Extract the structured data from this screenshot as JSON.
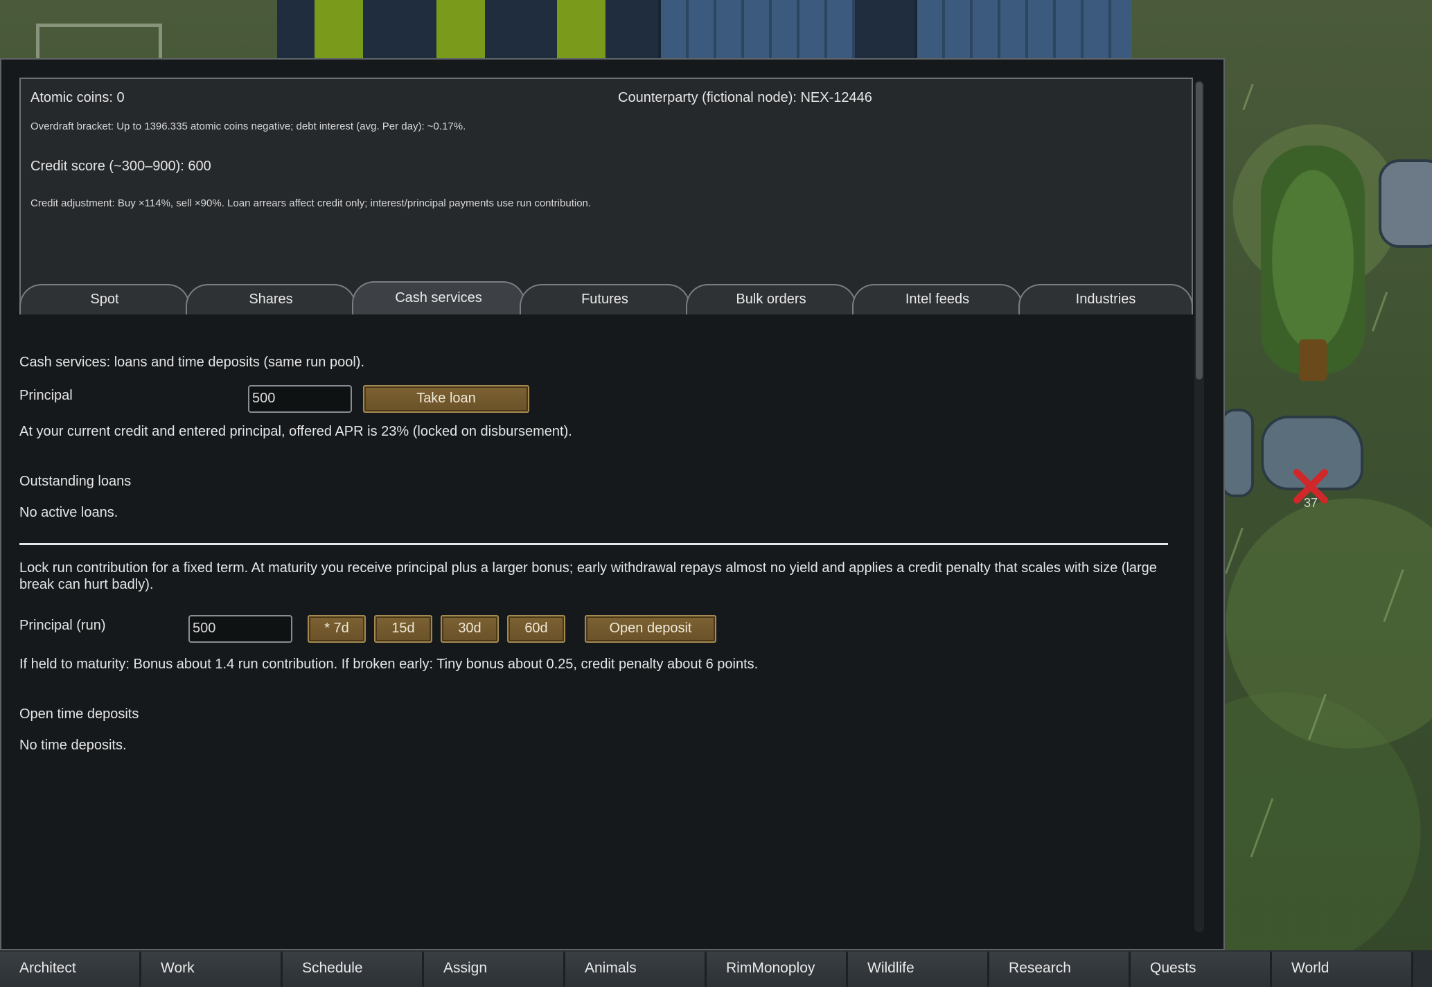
{
  "header": {
    "atomic_coins": "Atomic coins: 0",
    "counterparty": "Counterparty (fictional node): NEX-12446",
    "overdraft": "Overdraft bracket: Up to 1396.335 atomic coins negative; debt interest (avg. Per day): ~0.17%.",
    "credit_score": "Credit score (~300–900): 600",
    "credit_adjustment": "Credit adjustment: Buy ×114%, sell ×90%. Loan arrears affect credit only; interest/principal payments use run contribution."
  },
  "tabs": [
    {
      "label": "Spot"
    },
    {
      "label": "Shares"
    },
    {
      "label": "Cash services",
      "active": true
    },
    {
      "label": "Futures"
    },
    {
      "label": "Bulk orders"
    },
    {
      "label": "Intel feeds"
    },
    {
      "label": "Industries"
    }
  ],
  "loans": {
    "intro": "Cash services: loans and time deposits (same run pool).",
    "principal_label": "Principal",
    "principal_value": "500",
    "take_loan_label": "Take loan",
    "apr_note": "At your current credit and entered principal, offered APR is 23% (locked on disbursement).",
    "outstanding_header": "Outstanding loans",
    "no_loans": "No active loans."
  },
  "deposits": {
    "intro": "Lock run contribution for a fixed term. At maturity you receive principal plus a larger bonus; early withdrawal repays almost no yield and applies a credit penalty that scales with size (large break can hurt badly).",
    "principal_label": "Principal (run)",
    "principal_value": "500",
    "terms": [
      "* 7d",
      "15d",
      "30d",
      "60d"
    ],
    "open_label": "Open deposit",
    "maturity_note": "If held to maturity: Bonus about 1.4 run contribution. If broken early: Tiny bonus about 0.25, credit penalty about 6 points.",
    "open_header": "Open time deposits",
    "no_deposits": "No time deposits."
  },
  "world": {
    "marker_count": "37"
  },
  "bottom_bar": [
    {
      "label": "Architect"
    },
    {
      "label": "Work"
    },
    {
      "label": "Schedule"
    },
    {
      "label": "Assign"
    },
    {
      "label": "Animals"
    },
    {
      "label": "RimMonoploy"
    },
    {
      "label": "Wildlife"
    },
    {
      "label": "Research"
    },
    {
      "label": "Quests"
    },
    {
      "label": "World"
    }
  ],
  "colors": {
    "button_brown": "#6a5128",
    "panel_dark": "#15191c",
    "marker_red": "#d0282a"
  }
}
